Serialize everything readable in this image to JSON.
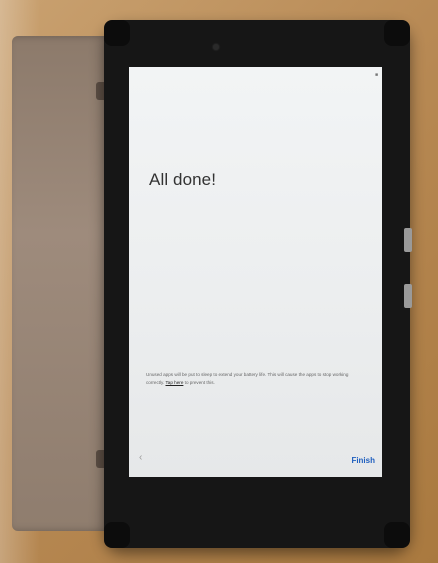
{
  "screen": {
    "title": "All done!",
    "notice_before": "Unused apps will be put to sleep to extend your battery life. This will cause the apps to stop working correctly.",
    "notice_link": "Tap here",
    "notice_after": "to prevent this.",
    "back_icon": "chevron-left-icon",
    "back_glyph": "‹",
    "finish_label": "Finish",
    "status_glyph": "■"
  },
  "colors": {
    "accent": "#1f5fbf",
    "screen_bg": "#eceeef",
    "bezel": "#161616",
    "wood": "#b88a55"
  }
}
